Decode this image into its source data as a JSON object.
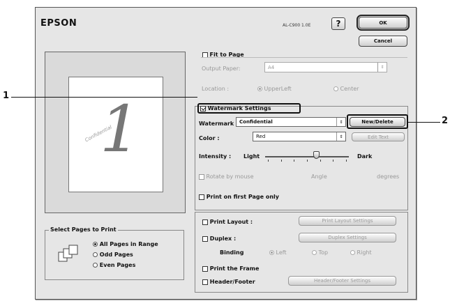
{
  "dialog": {
    "brand": "EPSON",
    "version": "AL-C900 1.0E",
    "help_glyph": "?",
    "ok_label": "OK",
    "cancel_label": "Cancel"
  },
  "fit_to_page": {
    "label": "Fit to Page",
    "checked": false,
    "output_paper_label": "Output Paper:",
    "output_paper_value": "A4",
    "location_label": "Location :",
    "location_options": [
      "UpperLeft",
      "Center"
    ],
    "location_selected": "UpperLeft"
  },
  "preview": {
    "page_number": "1",
    "watermark_text": "Confidential"
  },
  "watermark": {
    "settings_label": "Watermark Settings",
    "settings_checked": true,
    "watermark_label": "Watermark :",
    "watermark_value": "Confidential",
    "new_delete_label": "New/Delete",
    "color_label": "Color :",
    "color_value": "Red",
    "edit_text_label": "Edit Text",
    "intensity_label": "Intensity :",
    "intensity_light": "Light",
    "intensity_dark": "Dark",
    "intensity_level": 0.62,
    "rotate_label": "Rotate by mouse",
    "angle_label": "Angle",
    "degrees_label": "degrees",
    "first_page_label": "Print on first Page only"
  },
  "layout": {
    "print_layout_label": "Print Layout :",
    "print_layout_settings": "Print Layout Settings",
    "duplex_label": "Duplex :",
    "duplex_settings": "Duplex Settings",
    "binding_label": "Binding",
    "binding_options": [
      "Left",
      "Top",
      "Right"
    ],
    "binding_selected": "Left",
    "print_frame_label": "Print the Frame",
    "header_footer_label": "Header/Footer",
    "header_footer_settings": "Header/Footer Settings"
  },
  "pages": {
    "group_title": "Select Pages to Print",
    "options": [
      "All Pages in Range",
      "Odd Pages",
      "Even Pages"
    ],
    "selected": "All Pages in Range"
  },
  "callouts": [
    "1",
    "2"
  ]
}
